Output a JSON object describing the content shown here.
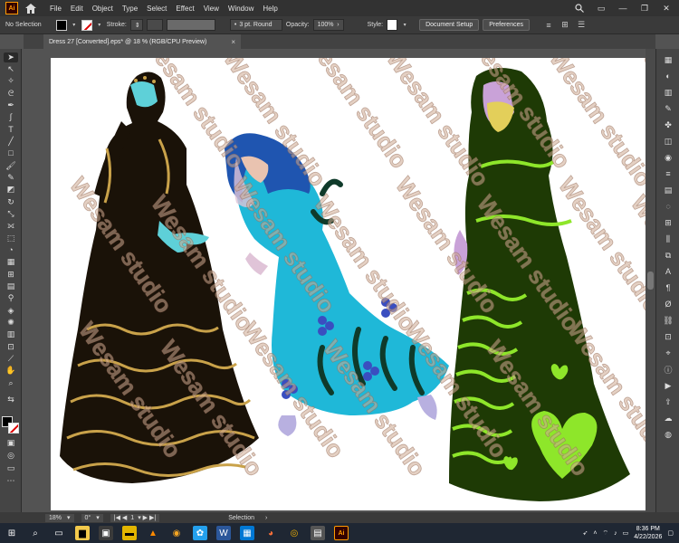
{
  "app": {
    "logo_text": "Ai"
  },
  "menu": {
    "items": [
      "File",
      "Edit",
      "Object",
      "Type",
      "Select",
      "Effect",
      "View",
      "Window",
      "Help"
    ]
  },
  "control_bar": {
    "selection": "No Selection",
    "stroke_label": "Stroke:",
    "brush": "3 pt. Round",
    "opacity_label": "Opacity:",
    "opacity_value": "100%",
    "style_label": "Style:",
    "document_setup": "Document Setup",
    "preferences": "Preferences"
  },
  "document": {
    "tab_title": "Dress 27 [Converted].eps* @ 18 % (RGB/CPU Preview)",
    "close_glyph": "×"
  },
  "watermark": {
    "text": "Wesam studio"
  },
  "status_bar": {
    "zoom": "18%",
    "rotation": "0°",
    "artboard": "1",
    "mode": "Selection"
  },
  "taskbar": {
    "time": "8:36 PM",
    "date": "4/22/2026",
    "app_icon_label": "Ai"
  },
  "colors": {
    "menubar": "#323232",
    "panel": "#454545",
    "canvas": "#535353",
    "accent_ai": "#ff9a00",
    "dress_black": "#1a1208",
    "dress_gold": "#c9a24a",
    "dress_cyan": "#1fb8d8",
    "dress_dark_green": "#1e3a05",
    "dress_lime": "#8ee62a"
  }
}
